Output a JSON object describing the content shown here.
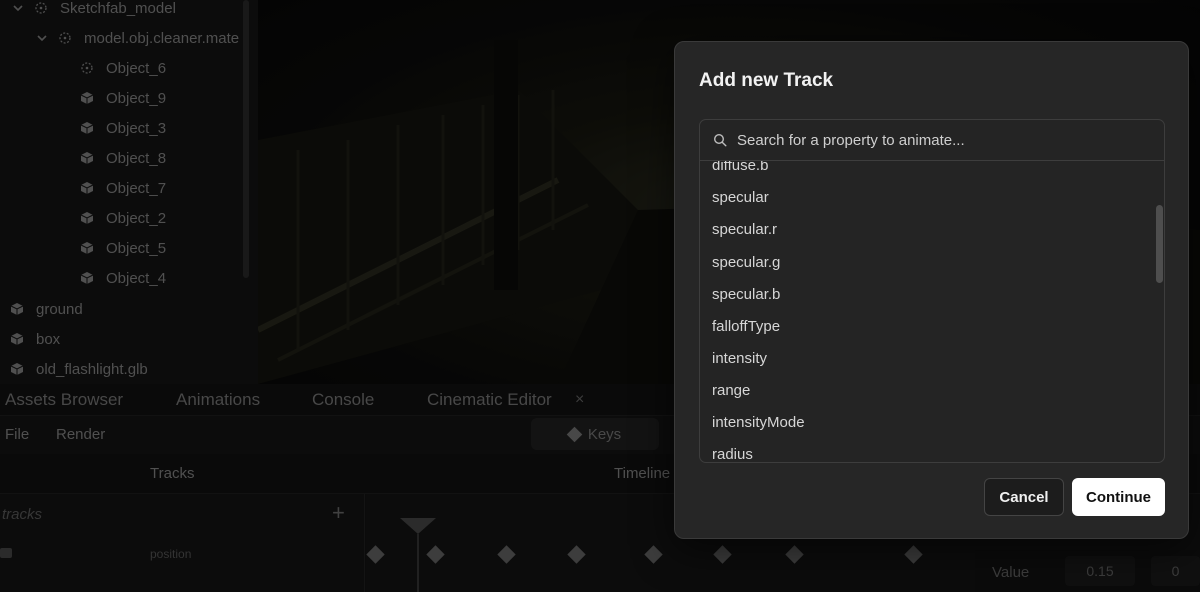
{
  "scene_tree": {
    "items": [
      {
        "label": "Sketchfab_model",
        "type": "group",
        "expanded": true
      },
      {
        "label": "model.obj.cleaner.mate",
        "type": "group",
        "expanded": true
      },
      {
        "label": "Object_6",
        "type": "group"
      },
      {
        "label": "Object_9",
        "type": "mesh"
      },
      {
        "label": "Object_3",
        "type": "mesh"
      },
      {
        "label": "Object_8",
        "type": "mesh"
      },
      {
        "label": "Object_7",
        "type": "mesh"
      },
      {
        "label": "Object_2",
        "type": "mesh"
      },
      {
        "label": "Object_5",
        "type": "mesh"
      },
      {
        "label": "Object_4",
        "type": "mesh"
      },
      {
        "label": "ground",
        "type": "mesh"
      },
      {
        "label": "box",
        "type": "mesh"
      },
      {
        "label": "old_flashlight.glb",
        "type": "mesh"
      }
    ]
  },
  "bottom_panel": {
    "tabs": [
      "Assets Browser",
      "Animations",
      "Console",
      "Cinematic Editor"
    ],
    "tab_close": "×",
    "menu": [
      "File",
      "Render"
    ],
    "keys_label": "Keys",
    "tracks_header": "Tracks",
    "timeline_header": "Timeline",
    "tracks_placeholder": "tracks",
    "add_track": "+",
    "track_position_label": "position",
    "value_label": "Value",
    "value_x": "0.15",
    "value_y": "0"
  },
  "modal": {
    "title": "Add new Track",
    "search_placeholder": "Search for a property to animate...",
    "properties": [
      "diffuse.b",
      "specular",
      "specular.r",
      "specular.g",
      "specular.b",
      "falloffType",
      "intensity",
      "range",
      "intensityMode",
      "radius"
    ],
    "cancel_label": "Cancel",
    "continue_label": "Continue"
  },
  "colors": {
    "modal_bg": "#262626",
    "primary_button_bg": "#ffffff",
    "overlay": "rgba(0,0,0,0.42)"
  }
}
